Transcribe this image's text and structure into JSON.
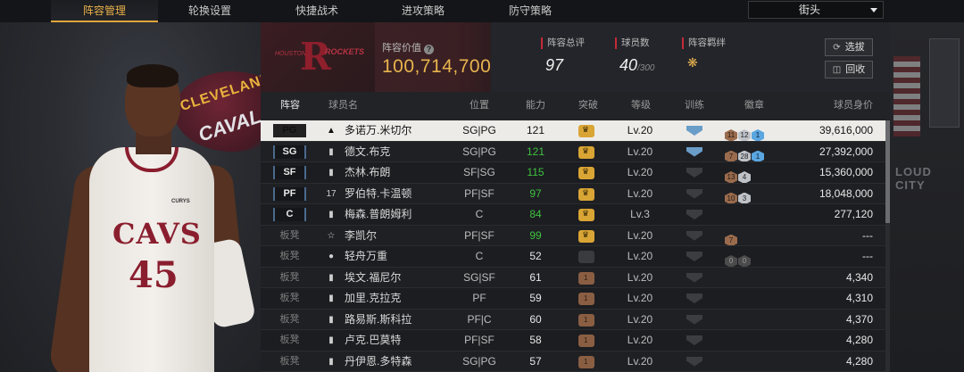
{
  "tabs": [
    {
      "label": "阵容管理",
      "active": true
    },
    {
      "label": "轮换设置",
      "active": false
    },
    {
      "label": "快捷战术",
      "active": false
    },
    {
      "label": "进攻策略",
      "active": false
    },
    {
      "label": "防守策略",
      "active": false
    }
  ],
  "jersey_select": {
    "value": "街头"
  },
  "team": {
    "logo_text": "ROCKETS",
    "logo_city": "HOUSTON",
    "value_label": "阵容价值",
    "value": "100,714,700",
    "overall_label": "阵容总评",
    "overall": "97",
    "count_label": "球员数",
    "count": "40",
    "count_max": "/300",
    "chemistry_label": "阵容羁绊"
  },
  "buttons": {
    "select": "选拔",
    "recycle": "回收"
  },
  "columns": {
    "lineup": "阵容",
    "name": "球员名",
    "position": "位置",
    "overall": "能力",
    "breakthrough": "突破",
    "level": "等级",
    "training": "训练",
    "badges": "徽章",
    "salary": "球员身价"
  },
  "players": [
    {
      "slot": "PG",
      "bench": false,
      "selected": true,
      "stack": "▲",
      "name": "多诺万.米切尔",
      "pos": "SG|PG",
      "ovr": "121",
      "ovr_color": "#2a9a2a",
      "brk": "gold",
      "level": "Lv.20",
      "train": "blue",
      "badges": [
        {
          "t": "11",
          "c": "bronze"
        },
        {
          "t": "12",
          "c": "silver"
        },
        {
          "t": "1",
          "c": "hof"
        }
      ],
      "salary": "39,616,000"
    },
    {
      "slot": "SG",
      "bench": false,
      "selected": false,
      "stack": "▮",
      "name": "德文.布克",
      "pos": "SG|PG",
      "ovr": "121",
      "ovr_color": "#3fc23f",
      "brk": "gold",
      "level": "Lv.20",
      "train": "blue",
      "badges": [
        {
          "t": "7",
          "c": "bronze"
        },
        {
          "t": "28",
          "c": "silver"
        },
        {
          "t": "1",
          "c": "hof"
        }
      ],
      "salary": "27,392,000"
    },
    {
      "slot": "SF",
      "bench": false,
      "selected": false,
      "stack": "▮",
      "name": "杰林.布朗",
      "pos": "SF|SG",
      "ovr": "115",
      "ovr_color": "#3fc23f",
      "brk": "gold",
      "level": "Lv.20",
      "train": "grey",
      "badges": [
        {
          "t": "13",
          "c": "bronze"
        },
        {
          "t": "4",
          "c": "silver"
        }
      ],
      "salary": "15,360,000"
    },
    {
      "slot": "PF",
      "bench": false,
      "selected": false,
      "stack": "17",
      "name": "罗伯特.卡温顿",
      "pos": "PF|SF",
      "ovr": "97",
      "ovr_color": "#3fc23f",
      "brk": "gold",
      "level": "Lv.20",
      "train": "grey",
      "badges": [
        {
          "t": "10",
          "c": "bronze"
        },
        {
          "t": "3",
          "c": "silver"
        }
      ],
      "salary": "18,048,000"
    },
    {
      "slot": "C",
      "bench": false,
      "selected": false,
      "stack": "▮",
      "name": "梅森.普朗姆利",
      "pos": "C",
      "ovr": "84",
      "ovr_color": "#3fc23f",
      "brk": "gold",
      "level": "Lv.3",
      "train": "grey",
      "badges": [],
      "salary": "277,120"
    },
    {
      "slot": "板凳",
      "bench": true,
      "selected": false,
      "stack": "☆",
      "name": "李凯尔",
      "pos": "PF|SF",
      "ovr": "99",
      "ovr_color": "#3fc23f",
      "brk": "gold",
      "level": "Lv.20",
      "train": "grey",
      "badges": [
        {
          "t": "7",
          "c": "bronze"
        }
      ],
      "salary": "---"
    },
    {
      "slot": "板凳",
      "bench": true,
      "selected": false,
      "stack": "●",
      "name": "轻舟万重",
      "pos": "C",
      "ovr": "52",
      "ovr_color": "#e8e8e8",
      "brk": "dark",
      "level": "Lv.20",
      "train": "grey",
      "badges": [
        {
          "t": "0",
          "c": "dark"
        },
        {
          "t": "0",
          "c": "dark"
        }
      ],
      "salary": "---"
    },
    {
      "slot": "板凳",
      "bench": true,
      "selected": false,
      "stack": "▮",
      "name": "埃文.福尼尔",
      "pos": "SG|SF",
      "ovr": "61",
      "ovr_color": "#e8e8e8",
      "brk": "bronze",
      "level": "Lv.20",
      "train": "grey",
      "badges": [],
      "salary": "4,340"
    },
    {
      "slot": "板凳",
      "bench": true,
      "selected": false,
      "stack": "▮",
      "name": "加里.克拉克",
      "pos": "PF",
      "ovr": "59",
      "ovr_color": "#e8e8e8",
      "brk": "bronze",
      "level": "Lv.20",
      "train": "grey",
      "badges": [],
      "salary": "4,310"
    },
    {
      "slot": "板凳",
      "bench": true,
      "selected": false,
      "stack": "▮",
      "name": "路易斯.斯科拉",
      "pos": "PF|C",
      "ovr": "60",
      "ovr_color": "#e8e8e8",
      "brk": "bronze",
      "level": "Lv.20",
      "train": "grey",
      "badges": [],
      "salary": "4,370"
    },
    {
      "slot": "板凳",
      "bench": true,
      "selected": false,
      "stack": "▮",
      "name": "卢克.巴莫特",
      "pos": "PF|SF",
      "ovr": "58",
      "ovr_color": "#e8e8e8",
      "brk": "bronze",
      "level": "Lv.20",
      "train": "grey",
      "badges": [],
      "salary": "4,280"
    },
    {
      "slot": "板凳",
      "bench": true,
      "selected": false,
      "stack": "▮",
      "name": "丹伊恩.多特森",
      "pos": "SG|PG",
      "ovr": "57",
      "ovr_color": "#e8e8e8",
      "brk": "bronze",
      "level": "Lv.20",
      "train": "grey",
      "badges": [],
      "salary": "4,280"
    }
  ],
  "player_art": {
    "jersey_text": "CAVS",
    "number": "45",
    "sponsor": "CURYS",
    "bg_team": "CLEVELAND",
    "bg_team2": "CAVALIERS",
    "deco_text": "LOUD CITY"
  },
  "colors": {
    "accent_gold": "#e8b44e",
    "team_red": "#c42a39",
    "ovr_green": "#3fc23f"
  }
}
